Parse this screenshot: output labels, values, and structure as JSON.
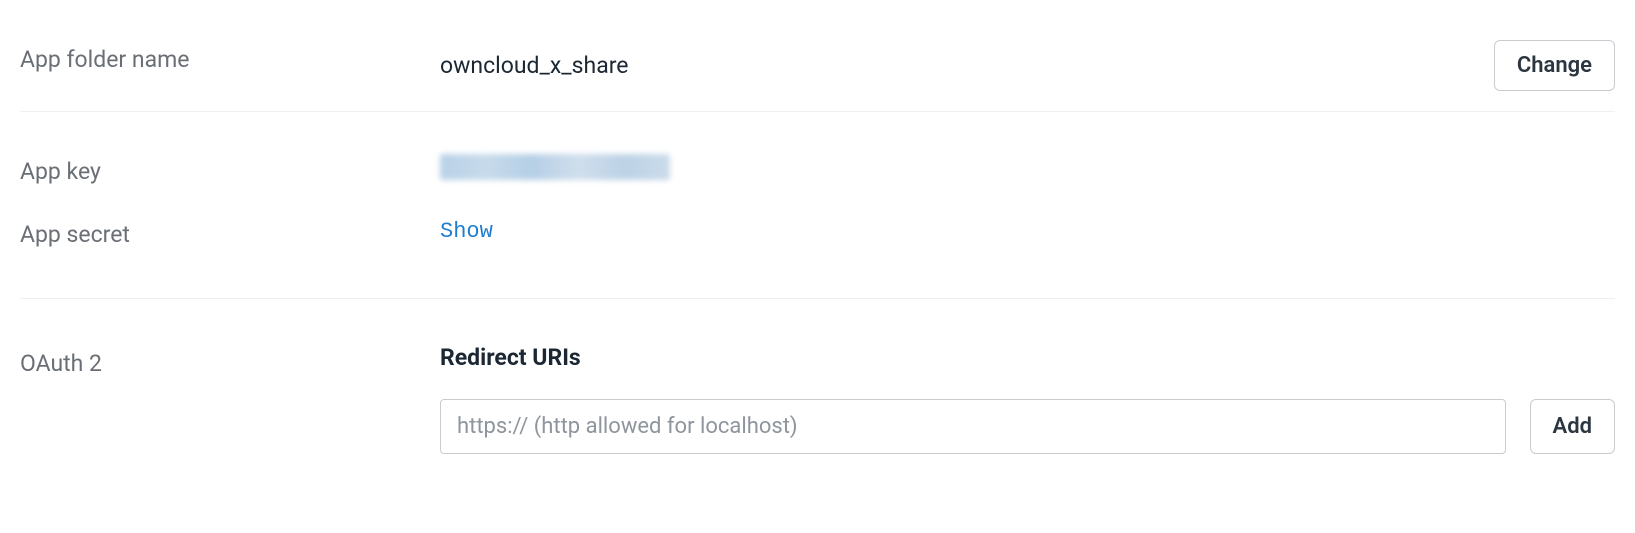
{
  "app_folder": {
    "label": "App folder name",
    "value": "owncloud_x_share",
    "change_button": "Change"
  },
  "app_key": {
    "label": "App key"
  },
  "app_secret": {
    "label": "App secret",
    "show_link": "Show"
  },
  "oauth": {
    "label": "OAuth 2",
    "redirect_heading": "Redirect URIs",
    "uri_placeholder": "https:// (http allowed for localhost)",
    "add_button": "Add"
  }
}
